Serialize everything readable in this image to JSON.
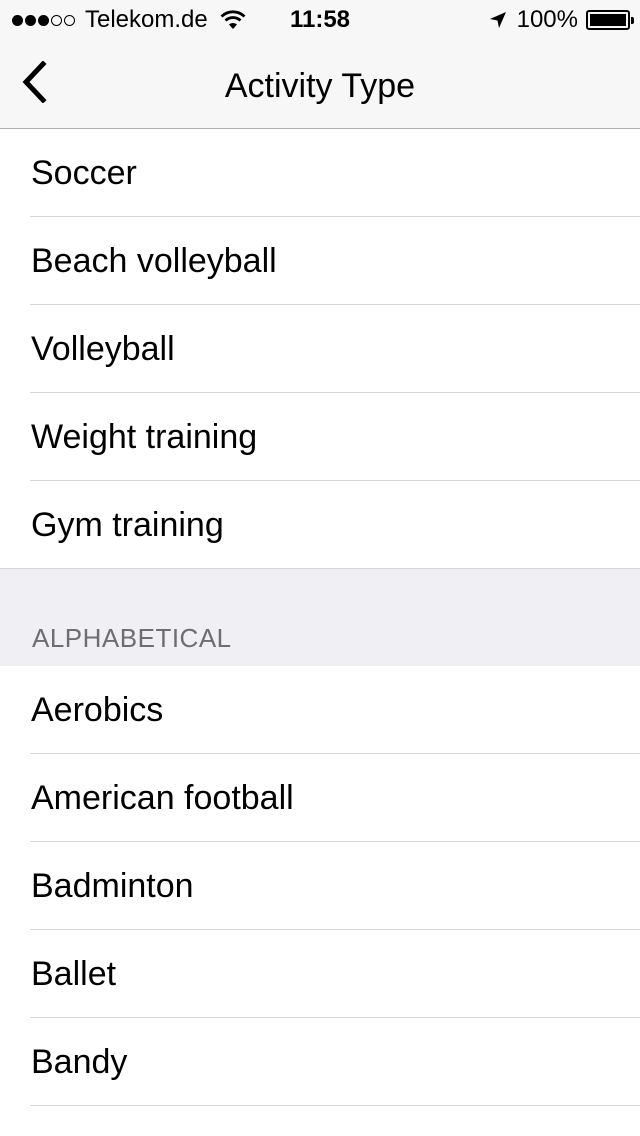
{
  "status_bar": {
    "carrier": "Telekom.de",
    "time": "11:58",
    "battery": "100%",
    "battery_level": 1.0,
    "signal_dots_filled": 3,
    "signal_dots_total": 5,
    "icons": [
      "wifi-icon",
      "location-arrow-icon",
      "battery-icon"
    ]
  },
  "nav": {
    "title": "Activity Type",
    "back_icon": "chevron-left-icon"
  },
  "recent_items": [
    "Soccer",
    "Beach volleyball",
    "Volleyball",
    "Weight training",
    "Gym training"
  ],
  "alphabetical": {
    "header": "ALPHABETICAL",
    "items": [
      "Aerobics",
      "American football",
      "Badminton",
      "Ballet",
      "Bandy"
    ]
  },
  "colors": {
    "bar_background": "#f7f7f7",
    "section_background": "#efeff4",
    "section_text": "#6d6d72",
    "separator": "#d6d6d8"
  }
}
